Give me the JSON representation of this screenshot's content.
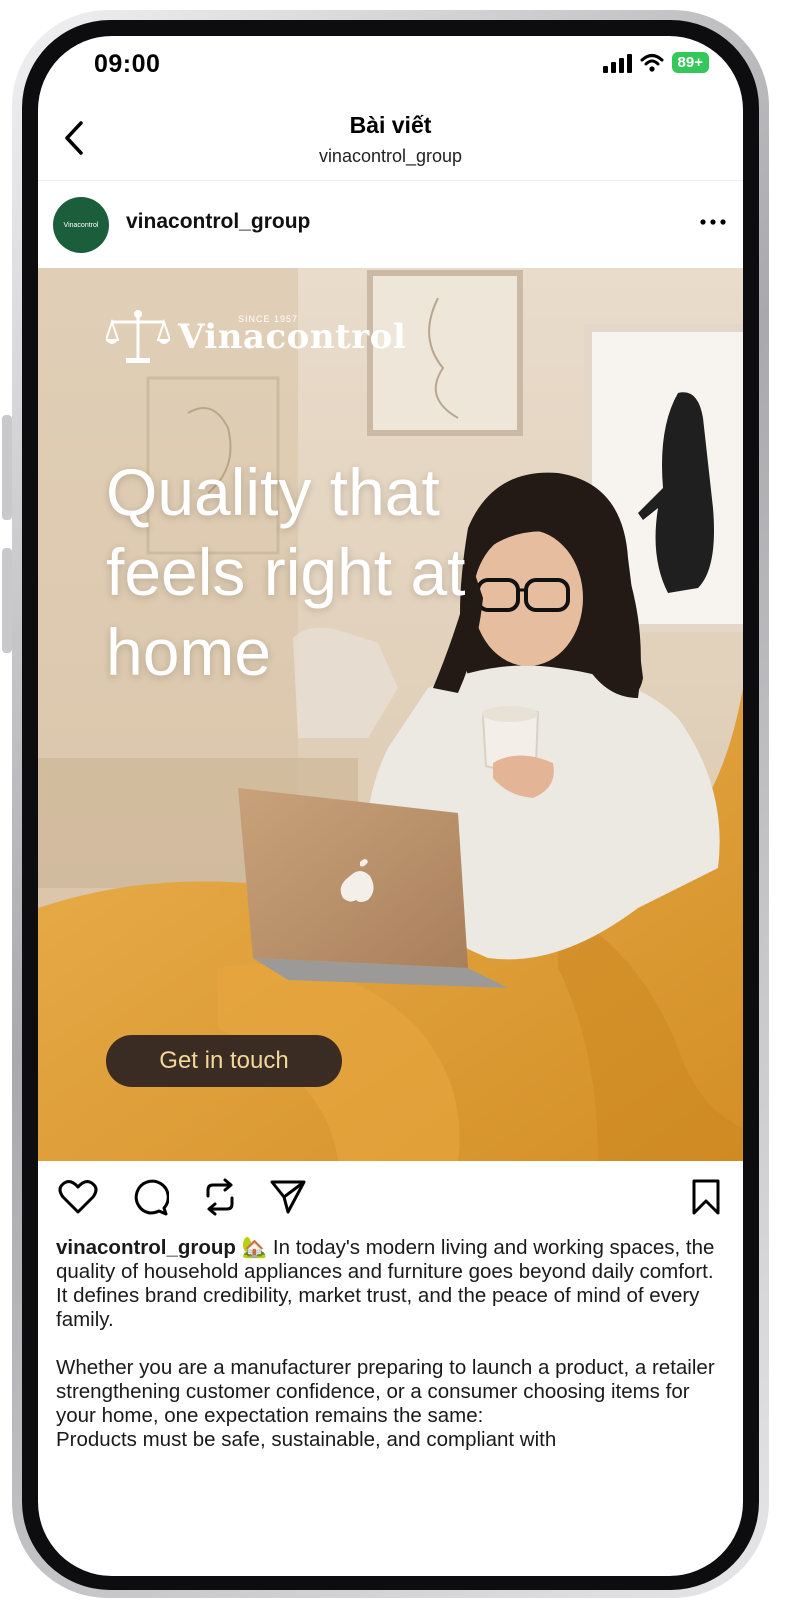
{
  "status_bar": {
    "time": "09:00",
    "battery": "89+"
  },
  "header": {
    "title": "Bài viết",
    "subtitle": "vinacontrol_group",
    "back_icon": "chevron-left-icon"
  },
  "post": {
    "avatar_text": "Vinacontrol",
    "username": "vinacontrol_group",
    "more_icon": "more-horizontal-icon",
    "image": {
      "brand_name": "Vinacontrol",
      "brand_since": "SINCE 1957",
      "headline": "Quality that feels right at home",
      "cta_label": "Get in touch"
    },
    "actions": [
      "heart-icon",
      "comment-icon",
      "repost-icon",
      "share-icon",
      "bookmark-icon"
    ],
    "caption": {
      "username": "vinacontrol_group",
      "emoji": "🏡",
      "line1": "In today's modern living and working spaces, the quality of household appliances and furniture goes beyond daily comfort.",
      "line2": "It defines brand credibility, market trust, and the peace of mind of every family.",
      "line3": "Whether you are a manufacturer preparing to launch a product, a retailer strengthening customer confidence, or a consumer choosing items for your home, one expectation remains the same:",
      "line4": "Products must be safe, sustainable, and compliant with"
    }
  },
  "colors": {
    "avatar_bg": "#1b5e3b",
    "cta_bg": "#3a2c22",
    "cta_text": "#f2d79b",
    "blanket": "#e0a238"
  }
}
